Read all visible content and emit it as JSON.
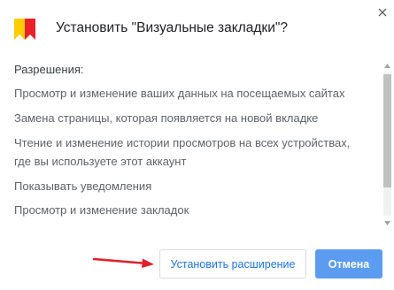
{
  "dialog": {
    "title": "Установить \"Визуальные закладки\"?",
    "icon": "yandex-bookmark-icon",
    "close_icon": "close-icon"
  },
  "permissions": {
    "heading": "Разрешения:",
    "items": [
      "Просмотр и изменение ваших данных на посещаемых сайтах",
      "Замена страницы, которая появляется на новой вкладке",
      "Чтение и изменение истории просмотров на всех устройствах, где вы используете этот аккаунт",
      "Показывать уведомления",
      "Просмотр и изменение закладок"
    ]
  },
  "buttons": {
    "install_label": "Установить расширение",
    "cancel_label": "Отмена"
  },
  "colors": {
    "accent": "#1a73e8",
    "cancel_bg": "#5b9cf0",
    "annotation_arrow": "#e0202a",
    "icon_yellow": "#ffcc00",
    "icon_red": "#e8212b"
  }
}
